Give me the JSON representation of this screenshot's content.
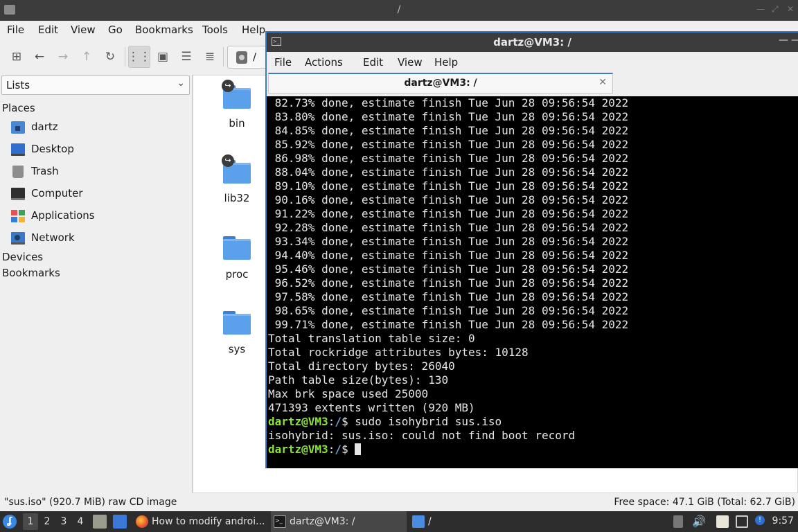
{
  "file_manager": {
    "title": "/",
    "menu": [
      "File",
      "Edit",
      "View",
      "Go",
      "Bookmarks",
      "Tools",
      "Help"
    ],
    "path_segment": "/",
    "side_panel_mode": "Lists",
    "places_heading": "Places",
    "places": [
      {
        "label": "dartz",
        "icon": "home-folder-icon"
      },
      {
        "label": "Desktop",
        "icon": "desktop-icon"
      },
      {
        "label": "Trash",
        "icon": "trash-icon"
      },
      {
        "label": "Computer",
        "icon": "computer-icon"
      },
      {
        "label": "Applications",
        "icon": "applications-icon"
      },
      {
        "label": "Network",
        "icon": "network-icon"
      }
    ],
    "devices_heading": "Devices",
    "bookmarks_heading": "Bookmarks",
    "folders": [
      {
        "name": "bin",
        "symlink": true
      },
      {
        "name": "lib32",
        "symlink": true
      },
      {
        "name": "proc",
        "symlink": false
      },
      {
        "name": "sys",
        "symlink": false
      }
    ],
    "status_left": "\"sus.iso\" (920.7 MiB) raw CD image",
    "status_right": "Free space: 47.1 GiB (Total: 62.7 GiB)"
  },
  "terminal": {
    "title": "dartz@VM3: /",
    "menu": [
      "File",
      "Actions",
      "Edit",
      "View",
      "Help"
    ],
    "tab_label": "dartz@VM3: /",
    "progress_lines": [
      " 82.73% done, estimate finish Tue Jun 28 09:56:54 2022",
      " 83.80% done, estimate finish Tue Jun 28 09:56:54 2022",
      " 84.85% done, estimate finish Tue Jun 28 09:56:54 2022",
      " 85.92% done, estimate finish Tue Jun 28 09:56:54 2022",
      " 86.98% done, estimate finish Tue Jun 28 09:56:54 2022",
      " 88.04% done, estimate finish Tue Jun 28 09:56:54 2022",
      " 89.10% done, estimate finish Tue Jun 28 09:56:54 2022",
      " 90.16% done, estimate finish Tue Jun 28 09:56:54 2022",
      " 91.22% done, estimate finish Tue Jun 28 09:56:54 2022",
      " 92.28% done, estimate finish Tue Jun 28 09:56:54 2022",
      " 93.34% done, estimate finish Tue Jun 28 09:56:54 2022",
      " 94.40% done, estimate finish Tue Jun 28 09:56:54 2022",
      " 95.46% done, estimate finish Tue Jun 28 09:56:54 2022",
      " 96.52% done, estimate finish Tue Jun 28 09:56:54 2022",
      " 97.58% done, estimate finish Tue Jun 28 09:56:54 2022",
      " 98.65% done, estimate finish Tue Jun 28 09:56:54 2022",
      " 99.71% done, estimate finish Tue Jun 28 09:56:54 2022"
    ],
    "summary_lines": [
      "Total translation table size: 0",
      "Total rockridge attributes bytes: 10128",
      "Total directory bytes: 26040",
      "Path table size(bytes): 130",
      "Max brk space used 25000",
      "471393 extents written (920 MB)"
    ],
    "prompt_user": "dartz@VM3",
    "prompt_path": "/",
    "prompt_symbol": "$",
    "command": " sudo isohybrid sus.iso",
    "error_line": "isohybrid: sus.iso: could not find boot record",
    "colors": {
      "background": "#000000",
      "text": "#e6e6e6",
      "prompt_user": "#8ae234",
      "prompt_path": "#729fcf"
    }
  },
  "taskbar": {
    "workspaces": [
      "1",
      "2",
      "3",
      "4"
    ],
    "current_workspace": "1",
    "tasks": [
      {
        "label": "How to modify androi...",
        "icon": "firefox-icon"
      },
      {
        "label": "dartz@VM3: /",
        "icon": "terminal-icon"
      },
      {
        "label": "/",
        "icon": "folder-icon"
      }
    ],
    "clock": "9:57"
  }
}
